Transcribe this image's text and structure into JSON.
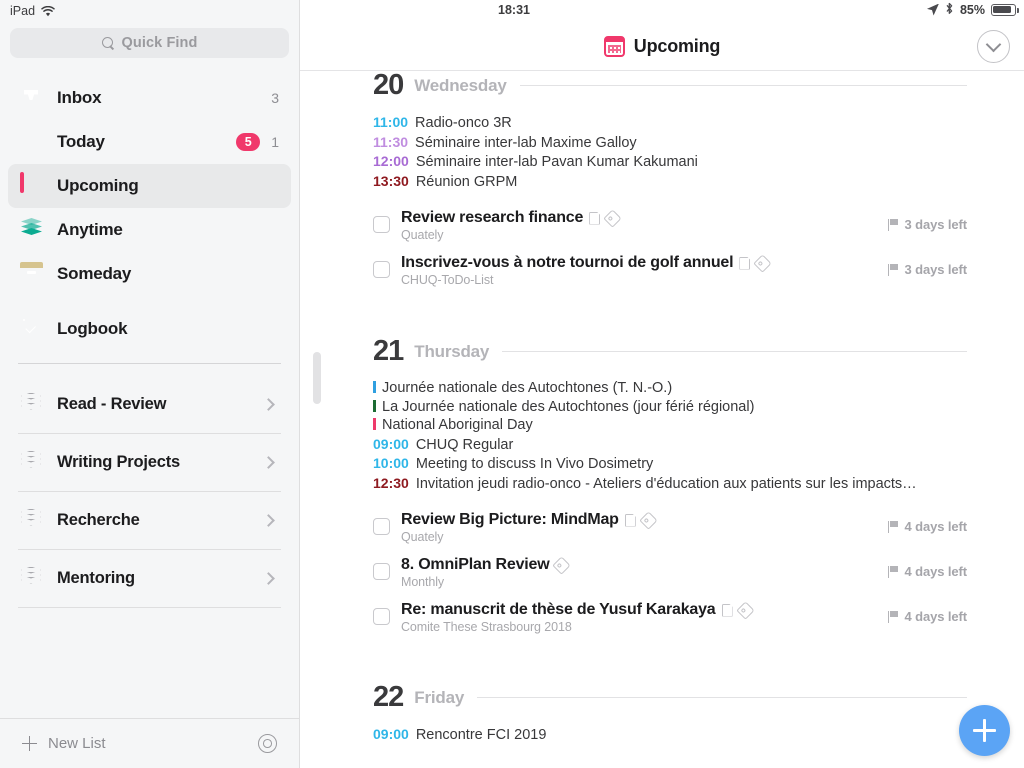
{
  "status_bar": {
    "device": "iPad",
    "wifi_icon": "wifi-icon",
    "time": "18:31",
    "location_icon": "location-arrow-icon",
    "bluetooth_icon": "bluetooth-icon",
    "battery_percent": "85%",
    "battery_icon": "battery-icon"
  },
  "sidebar": {
    "search": {
      "placeholder": "Quick Find",
      "icon": "search-icon"
    },
    "nav": [
      {
        "label": "Inbox",
        "icon": "inbox-icon",
        "count": "3",
        "badge": null,
        "selected": false
      },
      {
        "label": "Today",
        "icon": "star-icon",
        "count": "1",
        "badge": "5",
        "selected": false
      },
      {
        "label": "Upcoming",
        "icon": "calendar-icon",
        "count": null,
        "badge": null,
        "selected": true
      },
      {
        "label": "Anytime",
        "icon": "layers-icon",
        "count": null,
        "badge": null,
        "selected": false
      },
      {
        "label": "Someday",
        "icon": "box-icon",
        "count": null,
        "badge": null,
        "selected": false
      },
      {
        "label": "Logbook",
        "icon": "logbook-icon",
        "count": null,
        "badge": null,
        "selected": false
      }
    ],
    "projects": [
      {
        "label": "Read - Review",
        "icon": "stack-icon",
        "chevron": "chevron-right-icon"
      },
      {
        "label": "Writing Projects",
        "icon": "stack-icon",
        "chevron": "chevron-right-icon"
      },
      {
        "label": "Recherche",
        "icon": "stack-icon",
        "chevron": "chevron-right-icon"
      },
      {
        "label": "Mentoring",
        "icon": "stack-icon",
        "chevron": "chevron-right-icon"
      }
    ],
    "footer": {
      "new_list_label": "New List",
      "new_list_icon": "plus-icon",
      "settings_icon": "gear-icon"
    }
  },
  "header": {
    "title": "Upcoming",
    "title_icon": "calendar-icon",
    "collapse_icon": "chevron-down-circle-icon"
  },
  "colors": {
    "accent_pink": "#f0386b",
    "fab_blue": "#5ba4f5",
    "event_cyan": "#2fb6e8",
    "event_lilac": "#c08de0",
    "event_purple": "#a86bd4",
    "event_darkred": "#8f1a20",
    "event_blue_bar": "#2f9fe0",
    "event_green_bar": "#1c6b33",
    "event_pink_bar": "#ee3a6b",
    "sidebar_bg": "#f5f6f7"
  },
  "days": [
    {
      "number": "20",
      "weekday": "Wednesday",
      "events": [
        {
          "kind": "timed",
          "time": "11:00",
          "color": "#2fb6e8",
          "title": "Radio-onco 3R"
        },
        {
          "kind": "timed",
          "time": "11:30",
          "color": "#c08de0",
          "title": "Séminaire inter-lab Maxime Galloy"
        },
        {
          "kind": "timed",
          "time": "12:00",
          "color": "#a86bd4",
          "title": "Séminaire inter-lab Pavan Kumar Kakumani"
        },
        {
          "kind": "timed",
          "time": "13:30",
          "color": "#8f1a20",
          "title": "Réunion GRPM"
        }
      ],
      "tasks": [
        {
          "title": "Review research finance",
          "project": "Quately",
          "icons": [
            "note-icon",
            "tag-icon"
          ],
          "due": "3 days left",
          "due_icon": "flag-icon",
          "checkbox": "task-checkbox"
        },
        {
          "title": " Inscrivez-vous à notre tournoi de golf annuel",
          "project": "CHUQ-ToDo-List",
          "icons": [
            "note-icon",
            "tag-icon"
          ],
          "due": "3 days left",
          "due_icon": "flag-icon",
          "checkbox": "task-checkbox"
        }
      ]
    },
    {
      "number": "21",
      "weekday": "Thursday",
      "events": [
        {
          "kind": "allday",
          "color": "#2f9fe0",
          "title": "Journée nationale des Autochtones (T. N.-O.)"
        },
        {
          "kind": "allday",
          "color": "#1c6b33",
          "title": "La Journée nationale des Autochtones (jour férié régional)"
        },
        {
          "kind": "allday",
          "color": "#ee3a6b",
          "title": "National Aboriginal Day"
        },
        {
          "kind": "timed",
          "time": "09:00",
          "color": "#2fb6e8",
          "title": "CHUQ Regular"
        },
        {
          "kind": "timed",
          "time": "10:00",
          "color": "#2fb6e8",
          "title": "Meeting to discuss In Vivo Dosimetry"
        },
        {
          "kind": "timed",
          "time": "12:30",
          "color": "#8f1a20",
          "title": "Invitation jeudi radio-onco - Ateliers d'éducation aux patients sur les impacts…"
        }
      ],
      "tasks": [
        {
          "title": "Review Big Picture: MindMap",
          "project": "Quately",
          "icons": [
            "note-icon",
            "tag-icon"
          ],
          "due": "4 days left",
          "due_icon": "flag-icon",
          "checkbox": "task-checkbox"
        },
        {
          "title": "8. OmniPlan Review",
          "project": "Monthly",
          "icons": [
            "tag-icon"
          ],
          "due": "4 days left",
          "due_icon": "flag-icon",
          "checkbox": "task-checkbox"
        },
        {
          "title": "Re: manuscrit de thèse de Yusuf Karakaya",
          "project": "Comite These Strasbourg 2018",
          "icons": [
            "note-icon",
            "tag-icon"
          ],
          "due": "4 days left",
          "due_icon": "flag-icon",
          "checkbox": "task-checkbox"
        }
      ]
    },
    {
      "number": "22",
      "weekday": "Friday",
      "events": [
        {
          "kind": "timed",
          "time": "09:00",
          "color": "#2fb6e8",
          "title": "Rencontre FCI 2019"
        }
      ],
      "tasks": []
    }
  ],
  "fab": {
    "icon": "plus-icon",
    "label": "New To-Do"
  }
}
